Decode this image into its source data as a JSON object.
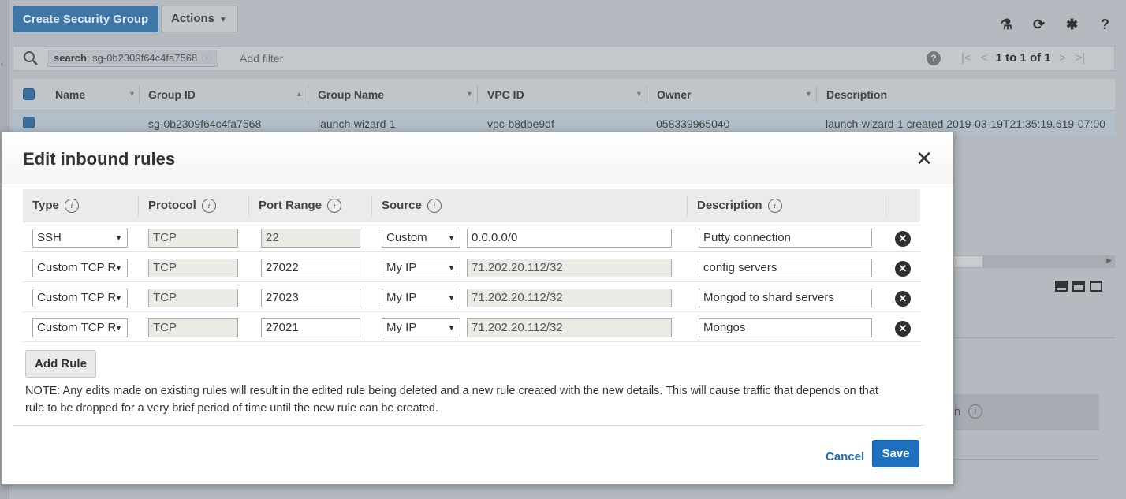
{
  "toolbar": {
    "create_label": "Create Security Group",
    "actions_label": "Actions"
  },
  "filter": {
    "token_key": "search",
    "token_value": ": sg-0b2309f64c4fa7568",
    "add_filter_placeholder": "Add filter",
    "pager_text": "1 to 1 of 1"
  },
  "grid": {
    "columns": [
      "Name",
      "Group ID",
      "Group Name",
      "VPC ID",
      "Owner",
      "Description"
    ],
    "row": {
      "name": "",
      "group_id": "sg-0b2309f64c4fa7568",
      "group_name": "launch-wizard-1",
      "vpc_id": "vpc-b8dbe9df",
      "owner": "058339965040",
      "description": "launch-wizard-1 created 2019-03-19T21:35:19.619-07:00"
    }
  },
  "background_panel": {
    "fragment": "n"
  },
  "modal": {
    "title": "Edit inbound rules",
    "headers": {
      "type": "Type",
      "protocol": "Protocol",
      "port_range": "Port Range",
      "source": "Source",
      "description": "Description"
    },
    "rules": [
      {
        "type": "SSH",
        "protocol": "TCP",
        "port": "22",
        "source_type": "Custom",
        "source": "0.0.0.0/0",
        "description": "Putty connection"
      },
      {
        "type": "Custom TCP R",
        "protocol": "TCP",
        "port": "27022",
        "source_type": "My IP",
        "source": "71.202.20.112/32",
        "description": "config servers"
      },
      {
        "type": "Custom TCP R",
        "protocol": "TCP",
        "port": "27023",
        "source_type": "My IP",
        "source": "71.202.20.112/32",
        "description": "Mongod to shard servers"
      },
      {
        "type": "Custom TCP R",
        "protocol": "TCP",
        "port": "27021",
        "source_type": "My IP",
        "source": "71.202.20.112/32",
        "description": "Mongos"
      }
    ],
    "add_rule_label": "Add Rule",
    "note": "NOTE: Any edits made on existing rules will result in the edited rule being deleted and a new rule created with the new details. This will cause traffic that depends on that rule to be dropped for a very brief period of time until the new rule can be created.",
    "cancel_label": "Cancel",
    "save_label": "Save"
  }
}
